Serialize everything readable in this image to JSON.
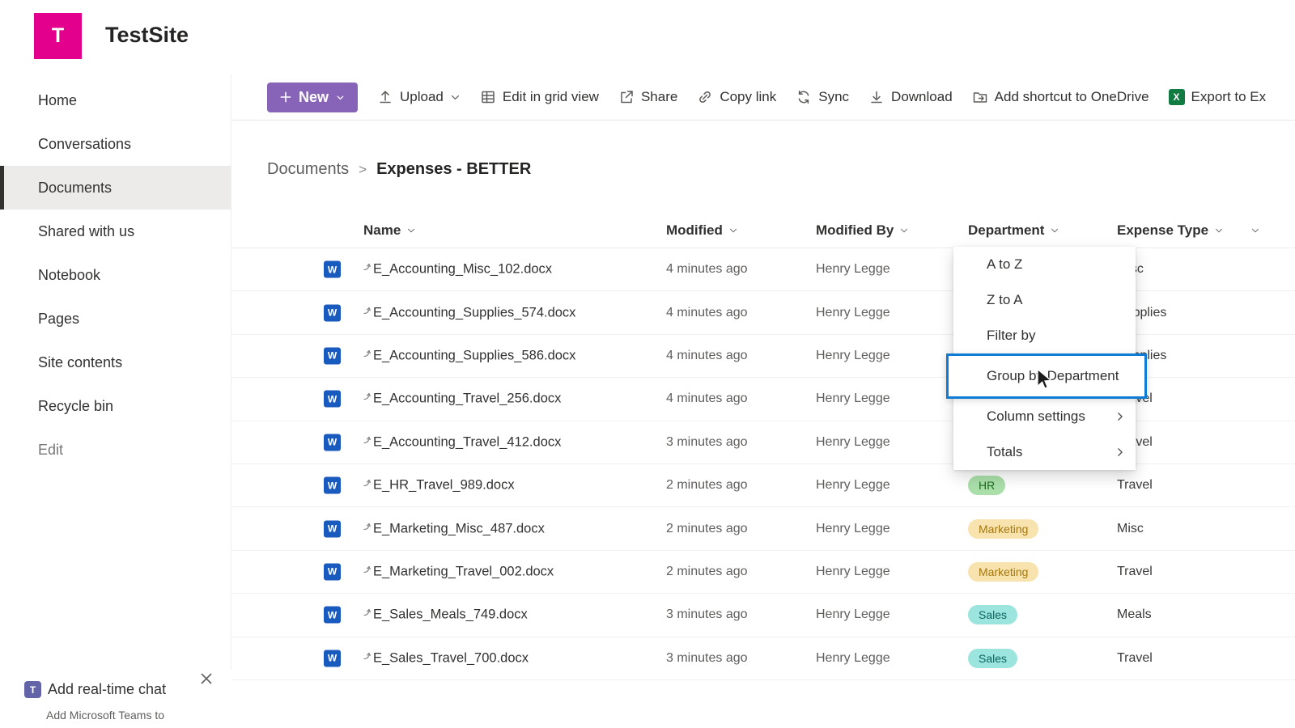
{
  "colors": {
    "accent": "#8764b8",
    "logo": "#e3008c",
    "highlight_border": "#0f7bd4",
    "excel_green": "#107c41",
    "word_blue": "#185abd"
  },
  "icons": {
    "word_letter": "W",
    "excel_letter": "X",
    "teams_letter": "T"
  },
  "site": {
    "logo_letter": "T",
    "title": "TestSite"
  },
  "sidebar": {
    "selected": "Documents",
    "items": [
      {
        "label": "Home"
      },
      {
        "label": "Conversations"
      },
      {
        "label": "Documents"
      },
      {
        "label": "Shared with us"
      },
      {
        "label": "Notebook"
      },
      {
        "label": "Pages"
      },
      {
        "label": "Site contents"
      },
      {
        "label": "Recycle bin"
      },
      {
        "label": "Edit",
        "muted": true
      }
    ],
    "chat_promo": {
      "title": "Add real-time chat",
      "subtitle": "Add Microsoft Teams to"
    }
  },
  "toolbar": {
    "new_button": {
      "label": "New"
    },
    "items": [
      {
        "label": "Upload",
        "icon": "upload-icon",
        "chevron": true
      },
      {
        "label": "Edit in grid view",
        "icon": "grid-icon"
      },
      {
        "label": "Share",
        "icon": "share-icon"
      },
      {
        "label": "Copy link",
        "icon": "copy-link-icon"
      },
      {
        "label": "Sync",
        "icon": "sync-icon"
      },
      {
        "label": "Download",
        "icon": "download-icon"
      },
      {
        "label": "Add shortcut to OneDrive",
        "icon": "shortcut-icon"
      },
      {
        "label": "Export to Ex",
        "icon": "excel-icon"
      }
    ]
  },
  "breadcrumb": {
    "root": "Documents",
    "separator": ">",
    "current": "Expenses - BETTER"
  },
  "table": {
    "columns": [
      {
        "label": "Name"
      },
      {
        "label": "Modified"
      },
      {
        "label": "Modified By"
      },
      {
        "label": "Department"
      },
      {
        "label": "Expense Type"
      }
    ],
    "rows": [
      {
        "name": "E_Accounting_Misc_102.docx",
        "modified": "4 minutes ago",
        "modified_by": "Henry Legge",
        "department": "",
        "expense": "Misc"
      },
      {
        "name": "E_Accounting_Supplies_574.docx",
        "modified": "4 minutes ago",
        "modified_by": "Henry Legge",
        "department": "",
        "expense": "Supplies"
      },
      {
        "name": "E_Accounting_Supplies_586.docx",
        "modified": "4 minutes ago",
        "modified_by": "Henry Legge",
        "department": "",
        "expense": "Supplies"
      },
      {
        "name": "E_Accounting_Travel_256.docx",
        "modified": "4 minutes ago",
        "modified_by": "Henry Legge",
        "department": "",
        "expense": "Travel"
      },
      {
        "name": "E_Accounting_Travel_412.docx",
        "modified": "3 minutes ago",
        "modified_by": "Henry Legge",
        "department": "",
        "expense": "Travel"
      },
      {
        "name": "E_HR_Travel_989.docx",
        "modified": "2 minutes ago",
        "modified_by": "Henry Legge",
        "department": "HR",
        "expense": "Travel"
      },
      {
        "name": "E_Marketing_Misc_487.docx",
        "modified": "2 minutes ago",
        "modified_by": "Henry Legge",
        "department": "Marketing",
        "expense": "Misc"
      },
      {
        "name": "E_Marketing_Travel_002.docx",
        "modified": "2 minutes ago",
        "modified_by": "Henry Legge",
        "department": "Marketing",
        "expense": "Travel"
      },
      {
        "name": "E_Sales_Meals_749.docx",
        "modified": "3 minutes ago",
        "modified_by": "Henry Legge",
        "department": "Sales",
        "expense": "Meals"
      },
      {
        "name": "E_Sales_Travel_700.docx",
        "modified": "3 minutes ago",
        "modified_by": "Henry Legge",
        "department": "Sales",
        "expense": "Travel"
      }
    ]
  },
  "department_styles": {
    "HR": {
      "bg": "#aadfaa",
      "fg": "#1c6e1c"
    },
    "Marketing": {
      "bg": "#f8e3ae",
      "fg": "#a3770e"
    },
    "Sales": {
      "bg": "#9ce4de",
      "fg": "#0c655d"
    }
  },
  "context_menu": {
    "items": [
      {
        "label": "A to Z"
      },
      {
        "label": "Z to A"
      },
      {
        "label": "Filter by"
      },
      {
        "label": "Group by Department",
        "highlighted": true
      },
      {
        "label": "Column settings",
        "submenu": true
      },
      {
        "label": "Totals",
        "submenu": true
      }
    ]
  }
}
